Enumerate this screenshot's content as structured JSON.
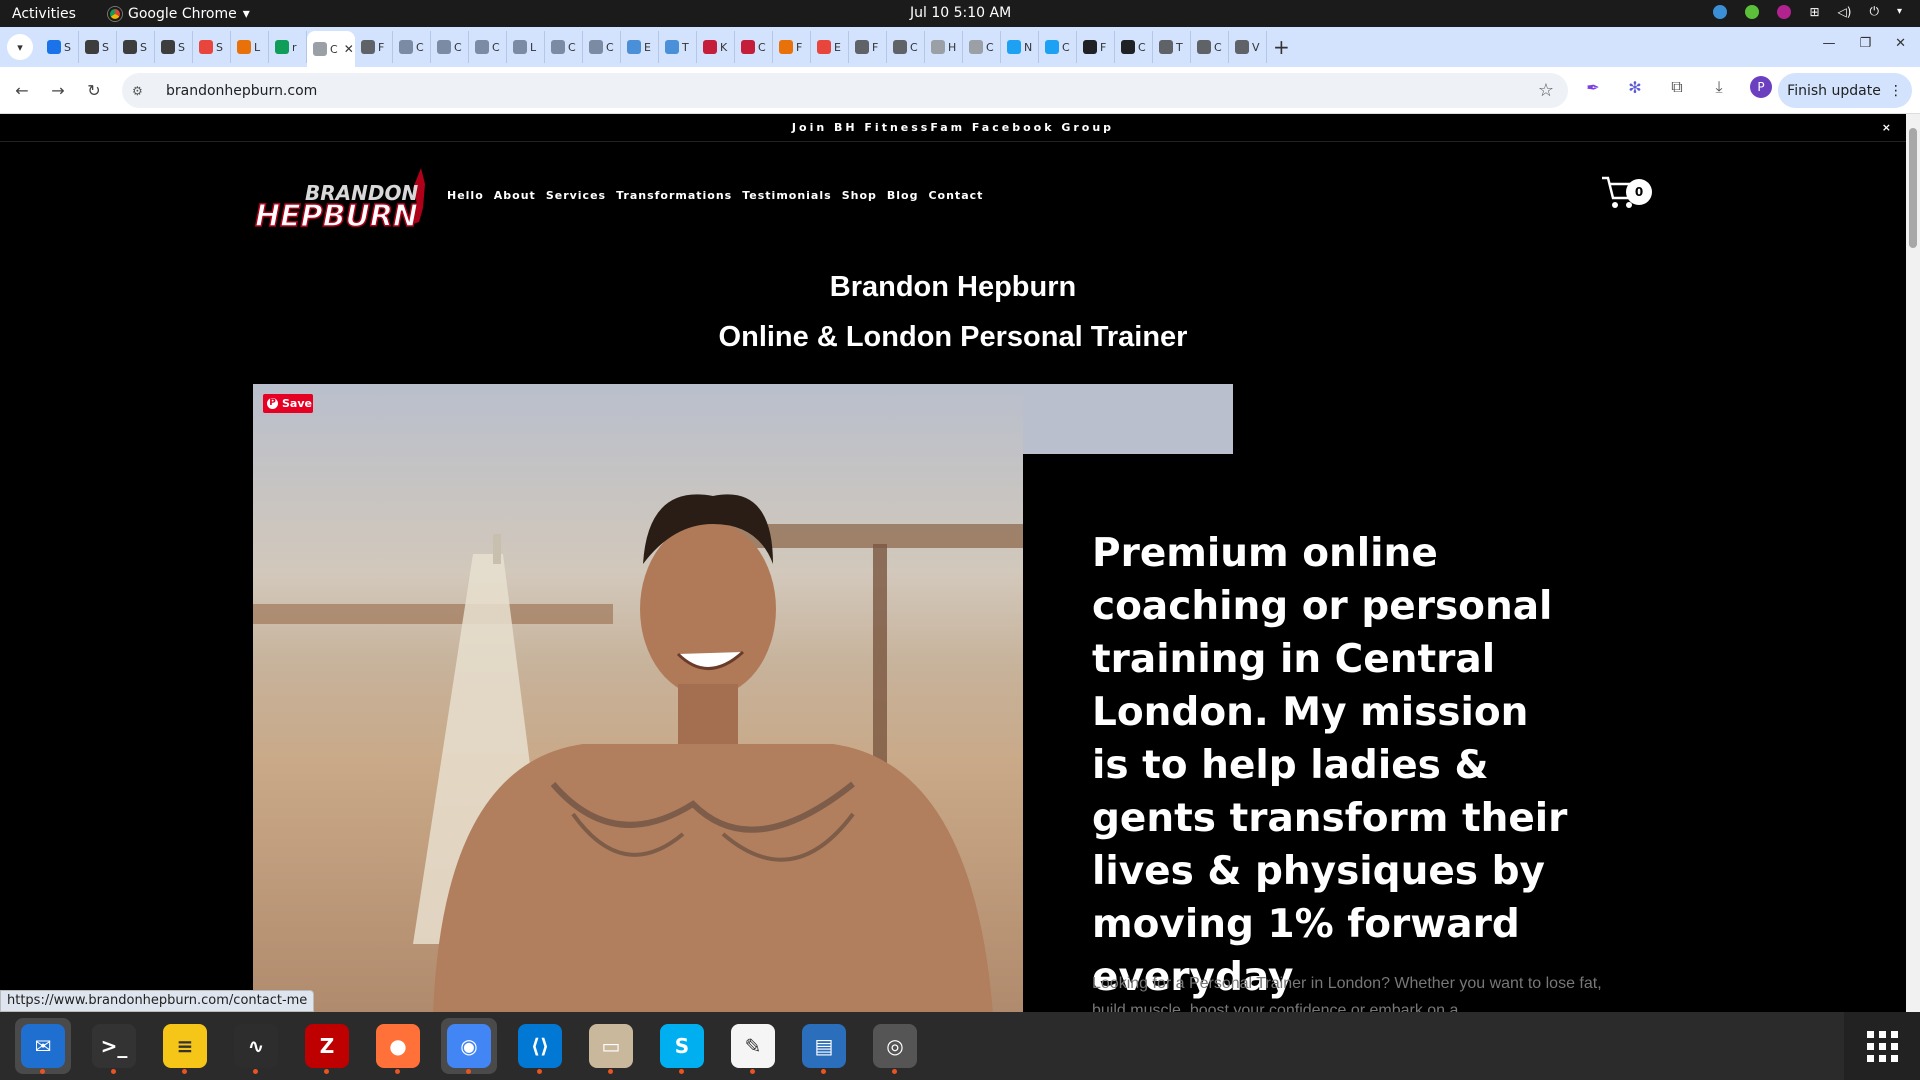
{
  "system": {
    "activities": "Activities",
    "app_name": "Google Chrome",
    "clock": "Jul 10  5:10 AM"
  },
  "tabs": [
    {
      "letter": "S",
      "color": "#1a73e8"
    },
    {
      "letter": "S",
      "color": "#3d3d3d"
    },
    {
      "letter": "S",
      "color": "#3d3d3d"
    },
    {
      "letter": "S",
      "color": "#3d3d3d"
    },
    {
      "letter": "S",
      "color": "#e8453c"
    },
    {
      "letter": "L",
      "color": "#e8710a"
    },
    {
      "letter": "r",
      "color": "#0f9d58"
    },
    {
      "letter": "C",
      "color": "#9aa0a6",
      "active": true
    },
    {
      "letter": "F",
      "color": "#5f6368"
    },
    {
      "letter": "C",
      "color": "#7a8ba3"
    },
    {
      "letter": "C",
      "color": "#7a8ba3"
    },
    {
      "letter": "C",
      "color": "#7a8ba3"
    },
    {
      "letter": "L",
      "color": "#7a8ba3"
    },
    {
      "letter": "C",
      "color": "#7a8ba3"
    },
    {
      "letter": "C",
      "color": "#7a8ba3"
    },
    {
      "letter": "E",
      "color": "#4a90d9"
    },
    {
      "letter": "T",
      "color": "#4a90d9"
    },
    {
      "letter": "K",
      "color": "#c41e3a"
    },
    {
      "letter": "C",
      "color": "#c41e3a"
    },
    {
      "letter": "F",
      "color": "#e8710a"
    },
    {
      "letter": "E",
      "color": "#e8453c"
    },
    {
      "letter": "F",
      "color": "#5f6368"
    },
    {
      "letter": "C",
      "color": "#5f6368"
    },
    {
      "letter": "H",
      "color": "#9aa0a6"
    },
    {
      "letter": "C",
      "color": "#9aa0a6"
    },
    {
      "letter": "N",
      "color": "#1da1f2"
    },
    {
      "letter": "C",
      "color": "#1da1f2"
    },
    {
      "letter": "F",
      "color": "#202124"
    },
    {
      "letter": "C",
      "color": "#202124"
    },
    {
      "letter": "T",
      "color": "#5f6368"
    },
    {
      "letter": "C",
      "color": "#5f6368"
    },
    {
      "letter": "V",
      "color": "#5f6368"
    }
  ],
  "toolbar": {
    "url": "brandonhepburn.com",
    "finish_update": "Finish update",
    "profile_initial": "P"
  },
  "site": {
    "announcement": "Join BH FitnessFam Facebook Group",
    "announcement_close": "×",
    "logo_line1": "BRANDON",
    "logo_line2": "HEPBURN",
    "nav": [
      "Hello",
      "About",
      "Services",
      "Transformations",
      "Testimonials",
      "Shop",
      "Blog",
      "Contact"
    ],
    "cart_count": "0",
    "title_line1": "Brandon Hepburn",
    "title_line2": "Online & London Personal Trainer",
    "pin_save": "Save",
    "headline": "Premium online coaching or personal training in Central London. My mission is to help ladies & gents transform their lives & physiques by moving 1% forward everyday",
    "subtext": "Looking for a Personal Trainer in London? Whether you want to lose fat, build muscle, boost your confidence or embark on a"
  },
  "status_url": "https://www.brandonhepburn.com/contact-me",
  "dock": [
    {
      "name": "thunderbird",
      "color": "#1f6fd1",
      "glyph": "✉",
      "active": true
    },
    {
      "name": "terminal",
      "color": "#333",
      "glyph": ">_"
    },
    {
      "name": "notes",
      "color": "#f5c518",
      "glyph": "≡"
    },
    {
      "name": "system-monitor",
      "color": "#2d2d2d",
      "glyph": "∿"
    },
    {
      "name": "filezilla",
      "color": "#bf0000",
      "glyph": "Z"
    },
    {
      "name": "firefox",
      "color": "#ff7139",
      "glyph": "●"
    },
    {
      "name": "chrome",
      "color": "#4285f4",
      "glyph": "◉",
      "active": true
    },
    {
      "name": "vscode",
      "color": "#0078d4",
      "glyph": "⟨⟩"
    },
    {
      "name": "files",
      "color": "#c9b89b",
      "glyph": "▭"
    },
    {
      "name": "skype",
      "color": "#00aff0",
      "glyph": "S"
    },
    {
      "name": "text-editor",
      "color": "#f5f5f5",
      "glyph": "✎"
    },
    {
      "name": "writer",
      "color": "#2a6ebc",
      "glyph": "▤"
    },
    {
      "name": "disk",
      "color": "#555",
      "glyph": "◎"
    }
  ]
}
